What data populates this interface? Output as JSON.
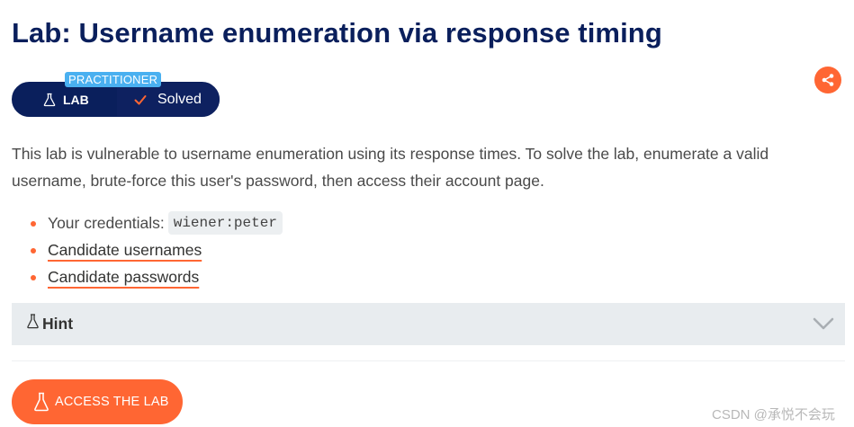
{
  "page": {
    "title": "Lab: Username enumeration via response timing"
  },
  "badge": {
    "level": "PRACTITIONER",
    "lab_label": "LAB",
    "status": "Solved"
  },
  "description": "This lab is vulnerable to username enumeration using its response times. To solve the lab, enumerate a valid username, brute-force this user's password, then access their account page.",
  "items": {
    "credentials_label": "Your credentials:",
    "credentials_value": "wiener:peter",
    "usernames_link": "Candidate usernames",
    "passwords_link": "Candidate passwords"
  },
  "hint": {
    "label": "Hint"
  },
  "access_button": {
    "label": "ACCESS THE LAB"
  },
  "watermark": "CSDN @承悦不会玩",
  "icons": {
    "share": "share-icon",
    "flask": "flask-icon",
    "check": "check-icon",
    "chevron": "chevron-down-icon"
  },
  "colors": {
    "title": "#0a1f5c",
    "accent": "#ff6633",
    "badge_bg": "#0a1f5c",
    "level_tag": "#4ab0f0",
    "hint_bg": "#e8ecef"
  }
}
